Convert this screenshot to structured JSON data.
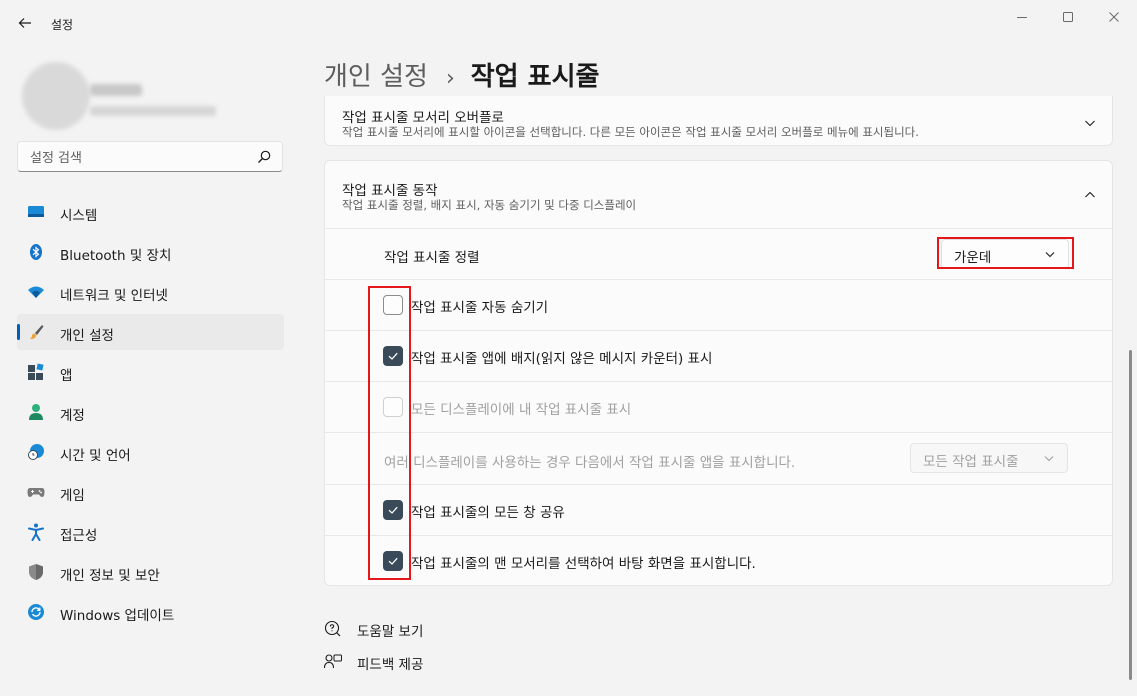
{
  "window": {
    "title": "설정"
  },
  "search": {
    "placeholder": "설정 검색"
  },
  "sidebar": {
    "items": [
      {
        "label": "시스템",
        "icon": "monitor-icon"
      },
      {
        "label": "Bluetooth 및 장치",
        "icon": "bluetooth-icon"
      },
      {
        "label": "네트워크 및 인터넷",
        "icon": "wifi-icon"
      },
      {
        "label": "개인 설정",
        "icon": "brush-icon",
        "active": true
      },
      {
        "label": "앱",
        "icon": "apps-icon"
      },
      {
        "label": "계정",
        "icon": "person-icon"
      },
      {
        "label": "시간 및 언어",
        "icon": "globe-clock-icon"
      },
      {
        "label": "게임",
        "icon": "gamepad-icon"
      },
      {
        "label": "접근성",
        "icon": "accessibility-icon"
      },
      {
        "label": "개인 정보 및 보안",
        "icon": "shield-icon"
      },
      {
        "label": "Windows 업데이트",
        "icon": "update-icon"
      }
    ]
  },
  "breadcrumb": {
    "parent": "개인 설정",
    "separator": "›",
    "current": "작업 표시줄"
  },
  "overflow_card": {
    "title": "작업 표시줄 모서리 오버플로",
    "description": "작업 표시줄 모서리에 표시할 아이콘을 선택합니다. 다른 모든 아이콘은 작업 표시줄 모서리 오버플로 메뉴에 표시됩니다."
  },
  "behavior_card": {
    "title": "작업 표시줄 동작",
    "description": "작업 표시줄 정렬, 배지 표시, 자동 숨기기 및 다중 디스플레이",
    "alignment": {
      "label": "작업 표시줄 정렬",
      "value": "가운데"
    },
    "auto_hide": {
      "label": "작업 표시줄 자동 숨기기",
      "checked": false
    },
    "badges": {
      "label": "작업 표시줄 앱에 배지(읽지 않은 메시지 카운터) 표시",
      "checked": true
    },
    "all_displays": {
      "label": "모든 디스플레이에 내 작업 표시줄 표시",
      "checked": false,
      "disabled": true
    },
    "multi_display": {
      "label": "여러 디스플레이를 사용하는 경우 다음에서 작업 표시줄 앱을 표시합니다.",
      "value": "모든 작업 표시줄",
      "disabled": true
    },
    "share_windows": {
      "label": "작업 표시줄의 모든 창 공유",
      "checked": true
    },
    "corner_desktop": {
      "label": "작업 표시줄의 맨 모서리를 선택하여 바탕 화면을 표시합니다.",
      "checked": true
    }
  },
  "links": {
    "help": "도움말 보기",
    "feedback": "피드백 제공"
  },
  "colors": {
    "accent": "#005fb8",
    "checkbox_checked": "#3a4a58",
    "highlight_box": "#e5171a",
    "background": "#f3f3f3",
    "card": "#fbfbfb"
  }
}
